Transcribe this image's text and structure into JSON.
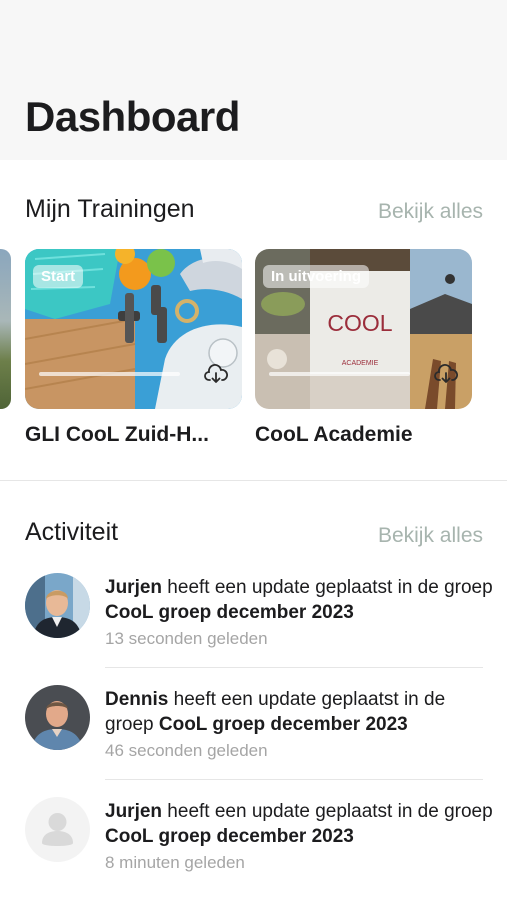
{
  "header": {
    "title": "Dashboard"
  },
  "trainings": {
    "title": "Mijn Trainingen",
    "see_all": "Bekijk alles",
    "cards": [
      {
        "badge": "Start",
        "label": "GLI CooL Zuid-H...",
        "progress": 0,
        "icon": "cloud-download-icon"
      },
      {
        "badge": "In uitvoering",
        "label": "CooL Academie",
        "progress": 0,
        "icon": "cloud-download-icon",
        "image_text": "COOL",
        "image_subtext": "ACADEMIE"
      }
    ]
  },
  "activity": {
    "title": "Activiteit",
    "see_all": "Bekijk alles",
    "items": [
      {
        "user": "Jurjen",
        "middle": " heeft een update geplaatst in de groep ",
        "group": "CooL groep december 2023",
        "time": "13 seconden geleden"
      },
      {
        "user": "Dennis",
        "middle": " heeft een update geplaatst in de groep ",
        "group": "CooL groep december 2023",
        "time": "46 seconden geleden"
      },
      {
        "user": "Jurjen",
        "middle": " heeft een update geplaatst in de groep ",
        "group": "CooL groep december 2023",
        "time": "8 minuten geleden"
      }
    ]
  },
  "colors": {
    "accent_muted": "#a7b4ae",
    "header_bg": "#f7f7f7"
  }
}
